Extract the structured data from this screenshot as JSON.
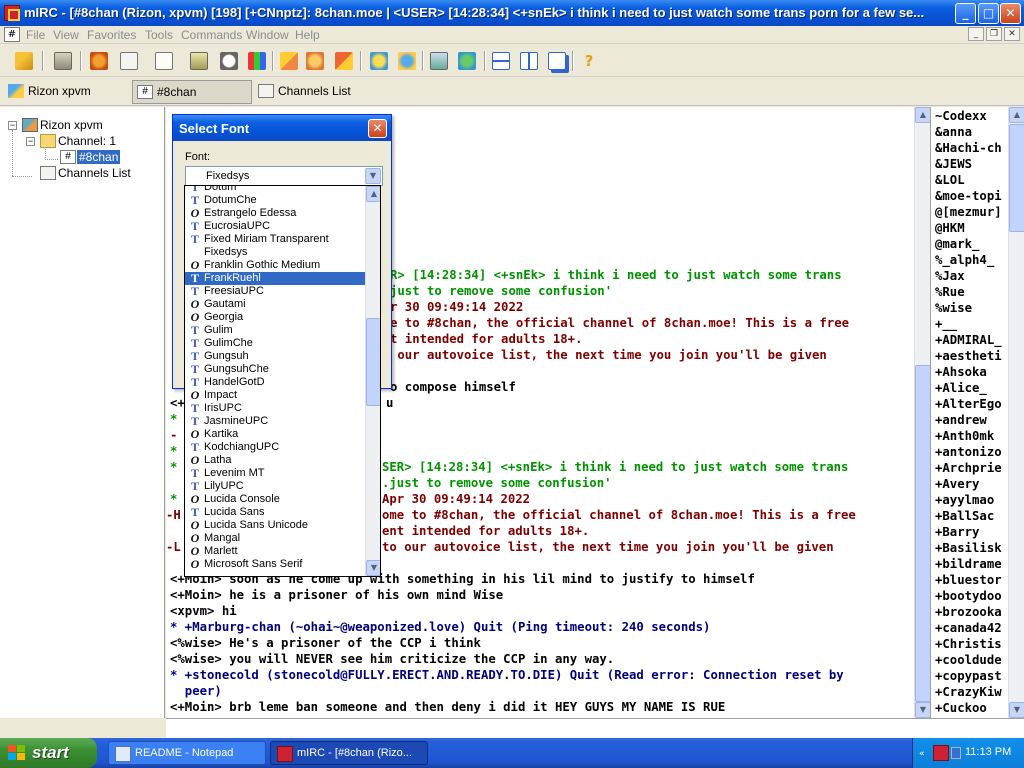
{
  "window": {
    "title": "mIRC - [#8chan (Rizon, xpvm) [198] [+CNnptz]: 8chan.moe  |  <USER> [14:28:34] <+snEk> i think i need to just watch some trans porn for a few se...",
    "min_label": "_",
    "max_label": "□",
    "close_label": "✕"
  },
  "menu": {
    "items": [
      "File",
      "View",
      "Favorites",
      "Tools",
      "Commands",
      "Window",
      "Help"
    ]
  },
  "toolbar": {
    "buttons": [
      "connect-icon",
      "options-icon",
      "favorites-icon",
      "channel-list-icon",
      "address-book-icon",
      "script-editor-icon",
      "dcc-icon",
      "timer-icon",
      "colors-icon",
      "notify-icon",
      "urls-icon",
      "log-icon",
      "send-icon",
      "chat-icon",
      "received-icon",
      "ignore-icon",
      "tile-horizontal-icon",
      "tile-vertical-icon",
      "cascade-icon",
      "help-icon"
    ]
  },
  "switchbar": {
    "tabs": [
      {
        "label": "Rizon xpvm",
        "icon": "server-icon"
      },
      {
        "label": "#8chan",
        "icon": "channel-icon"
      },
      {
        "label": "Channels List",
        "icon": "list-icon"
      }
    ]
  },
  "tree": {
    "server": "Rizon xpvm",
    "channel_folder": "Channel: 1",
    "channel": "#8chan",
    "channels_list": "Channels List"
  },
  "chat": {
    "lines": [
      {
        "text": "R> [14:28:34] <+snEk> i think i need to just watch some trans",
        "color": "green"
      },
      {
        "text": "just to remove some confusion'",
        "color": "green"
      },
      {
        "text": "r 30 09:49:14 2022",
        "color": "red"
      },
      {
        "text": "e to #8chan, the official channel of 8chan.moe! This is a free",
        "color": "red"
      },
      {
        "text": "t intended for adults 18+.",
        "color": "red"
      },
      {
        "text": " our autovoice list, the next time you join you'll be given",
        "color": "red"
      },
      {
        "text": "o compose himself",
        "color": "black"
      },
      {
        "text": "<+",
        "color": "black"
      },
      {
        "text": "*",
        "color": "green"
      },
      {
        "text": "-",
        "color": "red"
      },
      {
        "text": "*",
        "color": "green"
      },
      {
        "text": "SER> [14:28:34] <+snEk> i think i need to just watch some trans",
        "color": "green"
      },
      {
        "text": ".just to remove some confusion'",
        "color": "green"
      },
      {
        "text": "Apr 30 09:49:14 2022",
        "color": "red"
      },
      {
        "text": "ome to #8chan, the official channel of 8chan.moe! This is a free",
        "color": "red"
      },
      {
        "text": "ent intended for adults 18+.",
        "color": "red"
      },
      {
        "text": "to our autovoice list, the next time you join you'll be given",
        "color": "red"
      },
      {
        "text": "<+Moin> soon as he come up with something in his lil mind to justify to himself",
        "color": "black"
      },
      {
        "text": "<+Moin> he is a prisoner of his own mind Wise",
        "color": "black"
      },
      {
        "text": "<xpvm> hi",
        "color": "black"
      },
      {
        "text": "* +Marburg-chan (~ohai~@weaponized.love) Quit (Ping timeout: 240 seconds)",
        "color": "navy"
      },
      {
        "text": "<%wise> He's a prisoner of the CCP i think",
        "color": "black"
      },
      {
        "text": "<%wise> you will NEVER see him criticize the CCP in any way.",
        "color": "black"
      },
      {
        "text": "* +stonecold (stonecold@FULLY.ERECT.AND.READY.TO.DIE) Quit (Read error: Connection reset by",
        "color": "navy"
      },
      {
        "text": "  peer)",
        "color": "navy"
      },
      {
        "text": "<+Moin> brb leme ban someone and then deny i did it HEY GUYS MY NAME IS RUE",
        "color": "black"
      }
    ],
    "partial_left": {
      "u": "u",
      "star1": "*",
      "star2": "*",
      "star3": "*",
      "h": "-H",
      "l": "-L"
    }
  },
  "nicklist": [
    "~Codexx",
    "&anna",
    "&Hachi-ch",
    "&JEWS",
    "&LOL",
    "&moe-topi",
    "@[mezmur]",
    "@HKM",
    "@mark_",
    "%_alph4_",
    "%Jax",
    "%Rue",
    "%wise",
    "+__",
    "+ADMIRAL_",
    "+aestheti",
    "+Ahsoka",
    "+Alice_",
    "+AlterEgo",
    "+andrew",
    "+Anth0mk",
    "+antonizo",
    "+Archprie",
    "+Avery",
    "+ayylmao",
    "+BallSac",
    "+Barry",
    "+Basilisk",
    "+bildrame",
    "+bluestor",
    "+bootydoo",
    "+brozooka",
    "+canada42",
    "+Christis",
    "+cooldude",
    "+copypast",
    "+CrazyKiw",
    "+Cuckoo"
  ],
  "dialog": {
    "title": "Select Font",
    "font_label": "Font:",
    "font_value": "Fixedsys",
    "fonts": [
      {
        "name": "Dotum",
        "kind": "tt"
      },
      {
        "name": "DotumChe",
        "kind": "tt"
      },
      {
        "name": "Estrangelo Edessa",
        "kind": "ot"
      },
      {
        "name": "EucrosiaUPC",
        "kind": "tt"
      },
      {
        "name": "Fixed Miriam Transparent",
        "kind": "tt"
      },
      {
        "name": "Fixedsys",
        "kind": "none"
      },
      {
        "name": "Franklin Gothic Medium",
        "kind": "ot"
      },
      {
        "name": "FrankRuehl",
        "kind": "tt"
      },
      {
        "name": "FreesiaUPC",
        "kind": "tt"
      },
      {
        "name": "Gautami",
        "kind": "ot"
      },
      {
        "name": "Georgia",
        "kind": "ot"
      },
      {
        "name": "Gulim",
        "kind": "tt"
      },
      {
        "name": "GulimChe",
        "kind": "tt"
      },
      {
        "name": "Gungsuh",
        "kind": "tt"
      },
      {
        "name": "GungsuhChe",
        "kind": "tt"
      },
      {
        "name": "HandelGotD",
        "kind": "tt"
      },
      {
        "name": "Impact",
        "kind": "ot"
      },
      {
        "name": "IrisUPC",
        "kind": "tt"
      },
      {
        "name": "JasmineUPC",
        "kind": "tt"
      },
      {
        "name": "Kartika",
        "kind": "ot"
      },
      {
        "name": "KodchiangUPC",
        "kind": "tt"
      },
      {
        "name": "Latha",
        "kind": "ot"
      },
      {
        "name": "Levenim MT",
        "kind": "tt"
      },
      {
        "name": "LilyUPC",
        "kind": "tt"
      },
      {
        "name": "Lucida Console",
        "kind": "ot"
      },
      {
        "name": "Lucida Sans",
        "kind": "tt"
      },
      {
        "name": "Lucida Sans Unicode",
        "kind": "ot"
      },
      {
        "name": "Mangal",
        "kind": "ot"
      },
      {
        "name": "Marlett",
        "kind": "ot"
      },
      {
        "name": "Microsoft Sans Serif",
        "kind": "ot"
      }
    ],
    "selected": "FrankRuehl"
  },
  "taskbar": {
    "start_label": "start",
    "tasks": [
      {
        "label": "README - Notepad",
        "icon": "notepad-icon"
      },
      {
        "label": "mIRC - [#8chan (Rizo...",
        "icon": "mirc-icon"
      }
    ],
    "clock": "11:13 PM"
  },
  "colors": {
    "green": "#009300",
    "red": "#7f0000",
    "navy": "#00007f",
    "selection": "#316ac5",
    "xp_blue": "#0a5fe0"
  }
}
